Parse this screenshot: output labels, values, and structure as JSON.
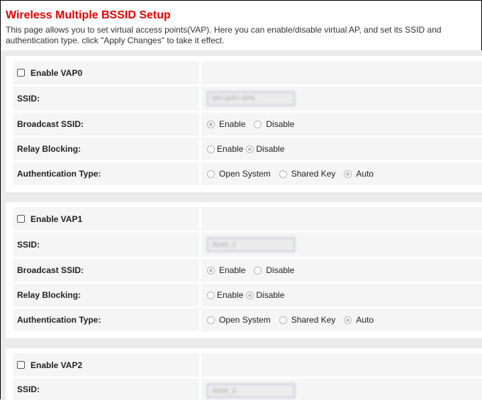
{
  "page": {
    "title": "Wireless Multiple BSSID Setup",
    "description": "This page allows you to set virtual access points(VAP). Here you can enable/disable virtual AP, and set its SSID and authentication type. click \"Apply Changes\" to take it effect."
  },
  "labels": {
    "ssid": "SSID:",
    "broadcast_ssid": "Broadcast SSID:",
    "relay_blocking": "Relay Blocking:",
    "authentication_type": "Authentication Type:",
    "enable": "Enable",
    "disable": "Disable",
    "open_system": "Open System",
    "shared_key": "Shared Key",
    "auto": "Auto"
  },
  "vaps": [
    {
      "enable_label": "Enable VAP0",
      "enabled": false,
      "ssid": "MY-WIFI-SPK",
      "broadcast": "Enable",
      "relay_blocking": "Disable",
      "auth": "Auto"
    },
    {
      "enable_label": "Enable VAP1",
      "enabled": false,
      "ssid": "Airtel_2",
      "broadcast": "Enable",
      "relay_blocking": "Disable",
      "auth": "Auto"
    },
    {
      "enable_label": "Enable VAP2",
      "enabled": false,
      "ssid": "Airtel_3"
    }
  ]
}
